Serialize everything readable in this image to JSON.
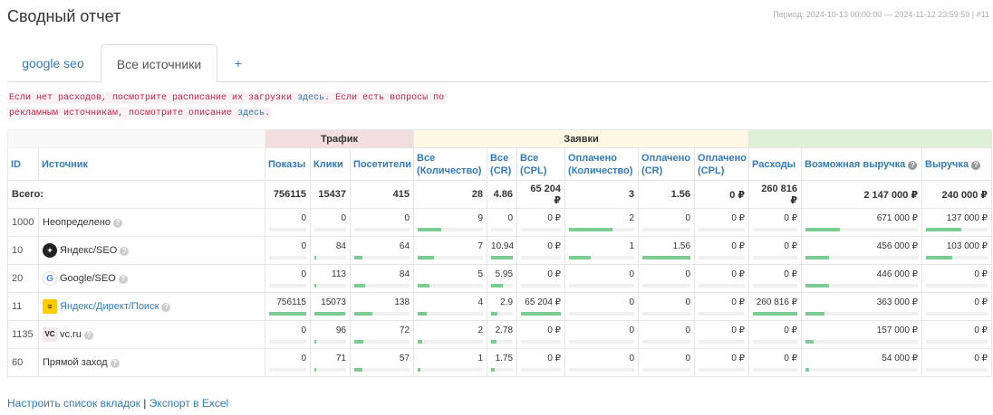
{
  "title": "Сводный отчет",
  "period": "Период: 2024-10-13 00:00:00 — 2024-11-12 23:59:59 | #11",
  "tabs": [
    {
      "label": "google seo",
      "active": false
    },
    {
      "label": "Все источники",
      "active": true
    },
    {
      "label": "+",
      "active": false
    }
  ],
  "notice": {
    "part1": "Если нет расходов, посмотрите расписание их загрузки",
    "link1": "здесь",
    "part2": ". Если есть вопросы по",
    "part3": "рекламным источникам, посмотрите описание",
    "link2": "здесь",
    "part4": "."
  },
  "groups": {
    "traffic": "Трафик",
    "apps": "Заявки"
  },
  "columns": {
    "id": "ID",
    "source": "Источник",
    "shows": "Показы",
    "clicks": "Клики",
    "visitors": "Посетители",
    "all_count": "Все (Количество)",
    "all_cr": "Все (CR)",
    "all_cpl": "Все (CPL)",
    "paid_count": "Оплачено (Количество)",
    "paid_cr": "Оплачено (CR)",
    "paid_cpl": "Оплачено (CPL)",
    "expenses": "Расходы",
    "possible_revenue": "Возможная выручка",
    "revenue": "Выручка"
  },
  "totals": {
    "label": "Всего:",
    "shows": "756115",
    "clicks": "15437",
    "visitors": "415",
    "all_count": "28",
    "all_cr": "4.86",
    "all_cpl": "65 204 ₽",
    "paid_count": "3",
    "paid_cr": "1.56",
    "paid_cpl": "0 ₽",
    "expenses": "260 816 ₽",
    "possible_revenue": "2 147 000 ₽",
    "revenue": "240 000 ₽"
  },
  "rows": [
    {
      "id": "1000",
      "source": "Неопределено",
      "icon": "none",
      "is_link": false,
      "shows": "0",
      "clicks": "0",
      "visitors": "0",
      "all_count": "9",
      "all_cr": "0",
      "all_cpl": "0 ₽",
      "paid_count": "2",
      "paid_cr": "0",
      "paid_cpl": "0 ₽",
      "expenses": "0 ₽",
      "possible_revenue": "671 000 ₽",
      "revenue": "137 000 ₽",
      "bars": {
        "shows": 0,
        "clicks": 0,
        "visitors": 0,
        "all_count": 0.36,
        "all_cr": 0,
        "all_cpl": 0,
        "paid_count": 0.67,
        "paid_cr": 0,
        "paid_cpl": 0,
        "expenses": 0,
        "possible_revenue": 0.31,
        "revenue": 0.57
      }
    },
    {
      "id": "10",
      "source": "Яндекс/SEO",
      "icon": "yandex",
      "is_link": false,
      "shows": "0",
      "clicks": "84",
      "visitors": "64",
      "all_count": "7",
      "all_cr": "10.94",
      "all_cpl": "0 ₽",
      "paid_count": "1",
      "paid_cr": "1.56",
      "paid_cpl": "0 ₽",
      "expenses": "0 ₽",
      "possible_revenue": "456 000 ₽",
      "revenue": "103 000 ₽",
      "bars": {
        "shows": 0,
        "clicks": 0.01,
        "visitors": 0.15,
        "all_count": 0.25,
        "all_cr": 1.0,
        "all_cpl": 0,
        "paid_count": 0.33,
        "paid_cr": 1.0,
        "paid_cpl": 0,
        "expenses": 0,
        "possible_revenue": 0.21,
        "revenue": 0.43
      }
    },
    {
      "id": "20",
      "source": "Google/SEO",
      "icon": "google",
      "is_link": false,
      "shows": "0",
      "clicks": "113",
      "visitors": "84",
      "all_count": "5",
      "all_cr": "5.95",
      "all_cpl": "0 ₽",
      "paid_count": "0",
      "paid_cr": "0",
      "paid_cpl": "0 ₽",
      "expenses": "0 ₽",
      "possible_revenue": "446 000 ₽",
      "revenue": "0 ₽",
      "bars": {
        "shows": 0,
        "clicks": 0.01,
        "visitors": 0.2,
        "all_count": 0.18,
        "all_cr": 0.54,
        "all_cpl": 0,
        "paid_count": 0,
        "paid_cr": 0,
        "paid_cpl": 0,
        "expenses": 0,
        "possible_revenue": 0.21,
        "revenue": 0
      }
    },
    {
      "id": "11",
      "source": "Яндекс/Директ/Поиск",
      "icon": "direct",
      "is_link": true,
      "shows": "756115",
      "clicks": "15073",
      "visitors": "138",
      "all_count": "4",
      "all_cr": "2.9",
      "all_cpl": "65 204 ₽",
      "paid_count": "0",
      "paid_cr": "0",
      "paid_cpl": "0 ₽",
      "expenses": "260 816 ₽",
      "possible_revenue": "363 000 ₽",
      "revenue": "0 ₽",
      "bars": {
        "shows": 1.0,
        "clicks": 0.98,
        "visitors": 0.33,
        "all_count": 0.14,
        "all_cr": 0.27,
        "all_cpl": 1.0,
        "paid_count": 0,
        "paid_cr": 0,
        "paid_cpl": 0,
        "expenses": 1.0,
        "possible_revenue": 0.17,
        "revenue": 0
      }
    },
    {
      "id": "1135",
      "source": "vc.ru",
      "icon": "vc",
      "is_link": false,
      "shows": "0",
      "clicks": "96",
      "visitors": "72",
      "all_count": "2",
      "all_cr": "2.78",
      "all_cpl": "0 ₽",
      "paid_count": "0",
      "paid_cr": "0",
      "paid_cpl": "0 ₽",
      "expenses": "0 ₽",
      "possible_revenue": "157 000 ₽",
      "revenue": "0 ₽",
      "bars": {
        "shows": 0,
        "clicks": 0.01,
        "visitors": 0.17,
        "all_count": 0.07,
        "all_cr": 0.25,
        "all_cpl": 0,
        "paid_count": 0,
        "paid_cr": 0,
        "paid_cpl": 0,
        "expenses": 0,
        "possible_revenue": 0.07,
        "revenue": 0
      }
    },
    {
      "id": "60",
      "source": "Прямой заход",
      "icon": "none",
      "is_link": false,
      "shows": "0",
      "clicks": "71",
      "visitors": "57",
      "all_count": "1",
      "all_cr": "1.75",
      "all_cpl": "0 ₽",
      "paid_count": "0",
      "paid_cr": "0",
      "paid_cpl": "0 ₽",
      "expenses": "0 ₽",
      "possible_revenue": "54 000 ₽",
      "revenue": "0 ₽",
      "bars": {
        "shows": 0,
        "clicks": 0.01,
        "visitors": 0.14,
        "all_count": 0.04,
        "all_cr": 0.16,
        "all_cpl": 0,
        "paid_count": 0,
        "paid_cr": 0,
        "paid_cpl": 0,
        "expenses": 0,
        "possible_revenue": 0.03,
        "revenue": 0
      }
    }
  ],
  "footer": {
    "configure": "Настроить список вкладок",
    "separator": "|",
    "export": "Экспорт в Excel"
  },
  "colors": {
    "bar_fill": "#7ccb92",
    "link": "#337ab7",
    "traffic_bg": "#f2dede",
    "apps_bg": "#fcf8e3",
    "money_bg": "#dff0d8"
  }
}
